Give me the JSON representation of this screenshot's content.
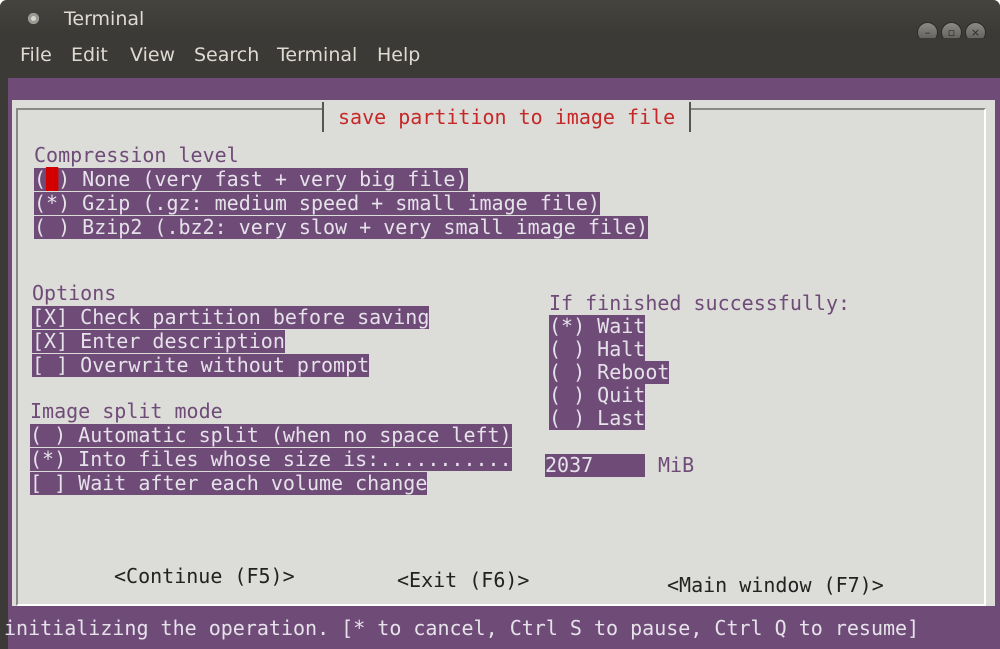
{
  "window": {
    "title": "Terminal"
  },
  "menu": [
    "File",
    "Edit",
    "View",
    "Search",
    "Terminal",
    "Help"
  ],
  "dialog": {
    "title": "save partition to image file",
    "compression": {
      "label": "Compression level",
      "options": [
        {
          "marker_open": "(",
          "marker_close": ")",
          "text": " None (very fast + very big file)",
          "selected": false
        },
        {
          "marker": "(*)",
          "text": " Gzip (.gz: medium speed + small image file)",
          "selected": true
        },
        {
          "marker": "( )",
          "text": " Bzip2 (.bz2: very slow + very small image file)",
          "selected": false
        }
      ]
    },
    "options": {
      "label": "Options",
      "items": [
        {
          "marker": "[X]",
          "text": " Check partition before saving",
          "checked": true
        },
        {
          "marker": "[X]",
          "text": " Enter description",
          "checked": true
        },
        {
          "marker": "[ ]",
          "text": " Overwrite without prompt",
          "checked": false
        }
      ]
    },
    "finished": {
      "label": "If finished successfully:",
      "options": [
        {
          "marker": "(*)",
          "text": " Wait"
        },
        {
          "marker": "( )",
          "text": " Halt"
        },
        {
          "marker": "( )",
          "text": " Reboot"
        },
        {
          "marker": "( )",
          "text": " Quit"
        },
        {
          "marker": "( )",
          "text": " Last"
        }
      ]
    },
    "split": {
      "label": "Image split mode",
      "items": [
        {
          "text": "( ) Automatic split (when no space left)"
        },
        {
          "text": "(*) Into files whose size is:..........."
        },
        {
          "text": "[ ] Wait after each volume change"
        }
      ],
      "size_value": "2037",
      "size_unit": "MiB"
    },
    "buttons": {
      "continue": "<Continue (F5)>",
      "exit": "<Exit (F6)>",
      "main": "<Main window (F7)>"
    }
  },
  "status": "initializing the operation. [* to cancel, Ctrl S to pause, Ctrl Q to resume]",
  "colors": {
    "accent": "#6f4b78",
    "title_red": "#c62828",
    "panel": "#dcdcd8"
  }
}
